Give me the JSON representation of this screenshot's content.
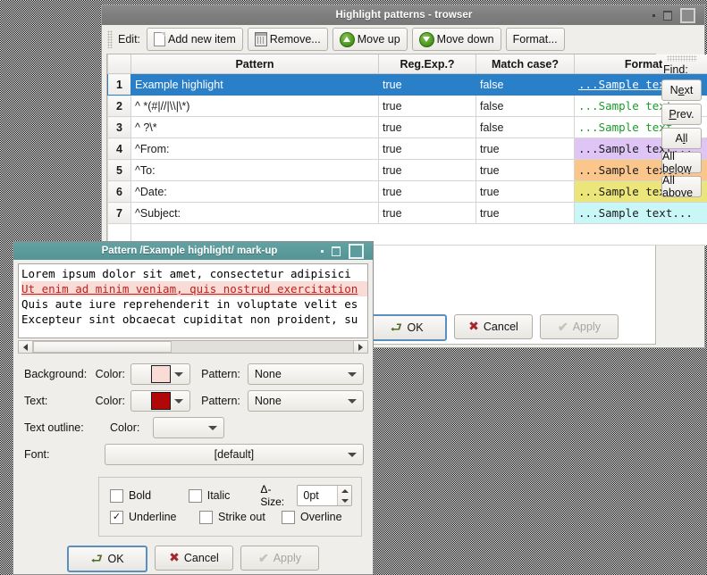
{
  "main_window": {
    "title": "Highlight patterns - trowser",
    "window_buttons": [
      "minimize-icon",
      "maximize-icon",
      "close-icon"
    ],
    "toolbar": {
      "label": "Edit:",
      "buttons": [
        {
          "label": "Add new item",
          "icon": "new-document-icon"
        },
        {
          "label": "Remove...",
          "icon": "trash-icon"
        },
        {
          "label": "Move up",
          "icon": "arrow-up-circle-icon"
        },
        {
          "label": "Move down",
          "icon": "arrow-down-circle-icon"
        },
        {
          "label": "Format...",
          "icon": "none"
        }
      ]
    },
    "table": {
      "headers": [
        "",
        "Pattern",
        "Reg.Exp.?",
        "Match case?",
        "Format"
      ],
      "rows": [
        {
          "num": "1",
          "pattern": "Example highlight",
          "regexp": "true",
          "match_case": "false",
          "format_text": "...Sample text...",
          "format_bg": "#fadcd6",
          "format_fg": "#c02020",
          "format_underline": true,
          "selected": true
        },
        {
          "num": "2",
          "pattern": "^ *(#|//|\\\\|\\*)",
          "regexp": "true",
          "match_case": "false",
          "format_text": "...Sample text...",
          "format_bg": "#ffffff",
          "format_fg": "#1a9b2a",
          "format_underline": false,
          "selected": false
        },
        {
          "num": "3",
          "pattern": "^ ?\\*",
          "regexp": "true",
          "match_case": "false",
          "format_text": "...Sample text...",
          "format_bg": "#ffffff",
          "format_fg": "#1a9b2a",
          "format_underline": false,
          "selected": false
        },
        {
          "num": "4",
          "pattern": "^From:",
          "regexp": "true",
          "match_case": "true",
          "format_text": "...Sample text...",
          "format_bg": "#dec5f5",
          "format_fg": "#1b1b1b",
          "format_underline": false,
          "selected": false
        },
        {
          "num": "5",
          "pattern": "^To:",
          "regexp": "true",
          "match_case": "true",
          "format_text": "...Sample text...",
          "format_bg": "#fac68c",
          "format_fg": "#1b1b1b",
          "format_underline": false,
          "selected": false
        },
        {
          "num": "6",
          "pattern": "^Date:",
          "regexp": "true",
          "match_case": "true",
          "format_text": "...Sample text...",
          "format_bg": "#ece67a",
          "format_fg": "#1b1b1b",
          "format_underline": false,
          "selected": false
        },
        {
          "num": "7",
          "pattern": "^Subject:",
          "regexp": "true",
          "match_case": "true",
          "format_text": "...Sample text...",
          "format_bg": "#c9f6f6",
          "format_fg": "#1b1b1b",
          "format_underline": false,
          "selected": false
        }
      ]
    },
    "find_panel": {
      "title": "Find:",
      "buttons": [
        {
          "label": "Next",
          "accel_index": 1
        },
        {
          "label": "Prev.",
          "accel_index": 0
        },
        {
          "label": "All",
          "accel_index": 1
        },
        {
          "label": "All below",
          "accel_index": -1
        },
        {
          "label": "All above",
          "accel_index": -1
        }
      ]
    },
    "dialog_buttons": [
      {
        "label": "OK",
        "icon": "ok-arrow-icon",
        "state": "default"
      },
      {
        "label": "Cancel",
        "icon": "cancel-x-icon",
        "state": "normal"
      },
      {
        "label": "Apply",
        "icon": "check-icon",
        "state": "disabled"
      }
    ]
  },
  "pattern_dialog": {
    "title": "Pattern /Example highlight/ mark-up",
    "window_buttons": [
      "minimize-icon",
      "maximize-icon",
      "close-icon"
    ],
    "preview_lines": [
      {
        "text": "Lorem ipsum dolor sit amet, consectetur adipisici",
        "highlighted": false
      },
      {
        "text": "Ut enim ad minim veniam, quis nostrud exercitation",
        "highlighted": true
      },
      {
        "text": "Quis aute iure reprehenderit in voluptate velit es",
        "highlighted": false
      },
      {
        "text": "Excepteur sint obcaecat cupiditat non proident, su",
        "highlighted": false
      }
    ],
    "fields": {
      "background_label": "Background:",
      "text_label": "Text:",
      "text_outline_label": "Text outline:",
      "color_label": "Color:",
      "pattern_label": "Pattern:",
      "font_label": "Font:",
      "background_color": "#fadcd6",
      "text_color": "#b00808",
      "text_outline_color": "",
      "background_pattern": "None",
      "text_pattern": "None",
      "font_value": "[default]"
    },
    "style": {
      "bold": {
        "label": "Bold",
        "checked": false
      },
      "italic": {
        "label": "Italic",
        "checked": false
      },
      "underline": {
        "label": "Underline",
        "checked": true
      },
      "strike_out": {
        "label": "Strike out",
        "checked": false
      },
      "overline": {
        "label": "Overline",
        "checked": false
      },
      "size_label": "Δ-Size:",
      "size_value": "0pt"
    },
    "dialog_buttons": [
      {
        "label": "OK",
        "icon": "ok-arrow-icon",
        "state": "default"
      },
      {
        "label": "Cancel",
        "icon": "cancel-x-icon",
        "state": "normal"
      },
      {
        "label": "Apply",
        "icon": "check-icon",
        "state": "disabled"
      }
    ]
  }
}
